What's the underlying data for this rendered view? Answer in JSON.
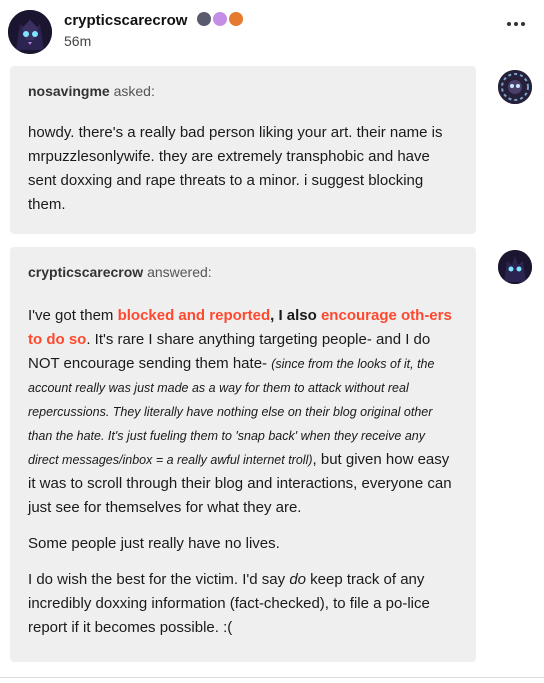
{
  "post": {
    "author": "crypticscarecrow",
    "time": "56m",
    "badges": [
      {
        "icon": "dark-badge-icon",
        "color": "#5a5a6e"
      },
      {
        "icon": "purple-badge-icon",
        "color": "#c48ee8"
      },
      {
        "icon": "orange-badge-icon",
        "color": "#e67a2e"
      }
    ]
  },
  "question": {
    "asker": "nosavingme",
    "verb": "asked:",
    "body": "howdy. there's a really bad person liking your art. their name is mrpuzzlesonlywife. they are extremely transphobic and have sent doxxing and rape threats to a minor. i suggest blocking them."
  },
  "answer": {
    "responder": "crypticscarecrow",
    "verb": "answered:",
    "p1_a": "I've got them ",
    "p1_b": "blocked and reported",
    "p1_c": ", I also ",
    "p1_d": "encourage oth-ers to do so",
    "p1_e": ". It's rare I share anything targeting people- and I do NOT encourage sending them hate- ",
    "p1_f": "(since from the looks of it, the account really was just made as a way for them to attack without real repercussions. They literally have nothing else on their blog original other than the hate. It's just fueling them to 'snap back' when they receive any direct messages/inbox = a really awful internet troll)",
    "p1_g": ", but given how easy it was to scroll through their blog and interactions, everyone can just see for themselves for what they are.",
    "p2": "Some people just really have no lives.",
    "p3_a": "I do wish the best for the victim. I'd say ",
    "p3_b": "do",
    "p3_c": " keep track of any incredibly doxxing information (fact-checked), to file a po-lice report if it becomes possible. :("
  },
  "colors": {
    "accent_red": "#ff492f",
    "bubble_bg": "#efefef"
  }
}
